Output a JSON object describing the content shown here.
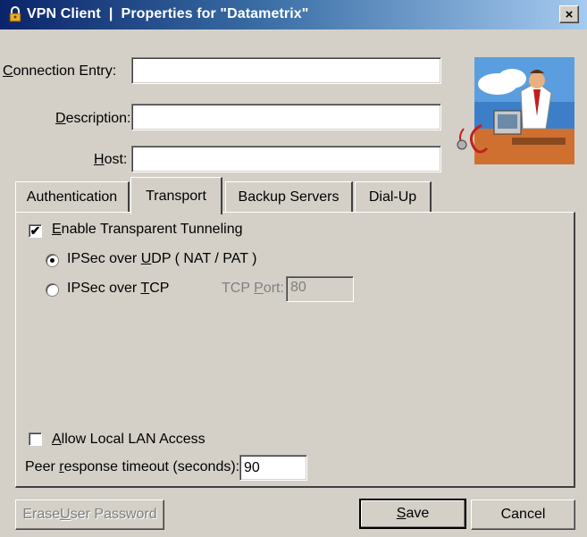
{
  "window": {
    "title": "VPN Client  |  Properties for \"Datametrix\"",
    "close_symbol": "×"
  },
  "fields": {
    "connection_entry": {
      "label_prefix": "",
      "label_ul": "C",
      "label_rest": "onnection Entry:",
      "value": ""
    },
    "description": {
      "label_prefix": "",
      "label_ul": "D",
      "label_rest": "escription:",
      "value": ""
    },
    "host": {
      "label_prefix": "",
      "label_ul": "H",
      "label_rest": "ost:",
      "value": ""
    }
  },
  "tabs": [
    {
      "label": "Authentication"
    },
    {
      "label": "Transport",
      "active": true
    },
    {
      "label": "Backup Servers"
    },
    {
      "label": "Dial-Up"
    }
  ],
  "transport": {
    "enable_tunneling": {
      "ul": "E",
      "rest": "nable Transparent Tunneling",
      "checked": true
    },
    "ipsec_udp": {
      "prefix": "IPSec over ",
      "ul": "U",
      "rest": "DP ( NAT / PAT )",
      "selected": true
    },
    "ipsec_tcp": {
      "prefix": "IPSec over ",
      "ul": "T",
      "rest": "CP",
      "selected": false
    },
    "tcp_port": {
      "prefix": "TCP ",
      "ul": "P",
      "rest": "ort:",
      "value": "80"
    },
    "allow_lan": {
      "ul": "A",
      "rest": "llow Local LAN Access",
      "checked": false
    },
    "peer_timeout": {
      "prefix": "Peer ",
      "ul": "r",
      "rest": "esponse timeout (seconds):",
      "value": "90"
    }
  },
  "buttons": {
    "erase": {
      "prefix": "Erase ",
      "ul": "U",
      "rest": "ser Password"
    },
    "save": {
      "ul": "S",
      "rest": "ave"
    },
    "cancel": {
      "label": "Cancel"
    }
  },
  "icons": {
    "app": "vpn-lock-icon",
    "illustration": "network-user-illustration",
    "checkmark": "✔"
  }
}
